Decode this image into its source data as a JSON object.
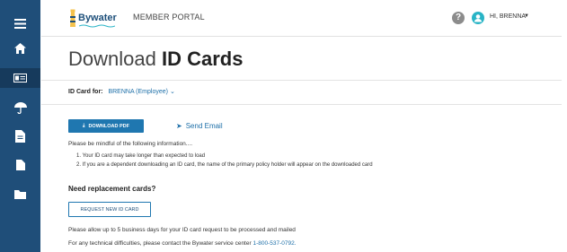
{
  "app": {
    "logo_text": "Bywater",
    "portal_title": "MEMBER PORTAL",
    "help_label": "?",
    "greeting": "HI, BRENNA"
  },
  "sidebar": {
    "icons": [
      "menu-icon",
      "home-icon",
      "id-card-icon",
      "umbrella-icon",
      "document-icon",
      "file-icon",
      "folder-icon"
    ],
    "active": "id-card-icon"
  },
  "page": {
    "title_prefix": "Download",
    "title_main": "ID Cards"
  },
  "idcard": {
    "label": "ID Card for:",
    "selected": "BRENNA (Employee)"
  },
  "actions": {
    "download_label": "DOWNLOAD PDF",
    "send_email_label": "Send Email"
  },
  "info": {
    "intro": "Please be mindful of the following information....",
    "items": [
      "1. Your ID card may take longer than expected to load",
      "2. If you are a dependent downloading an ID card, the name of the primary policy holder will appear on the downloaded card"
    ]
  },
  "replacement": {
    "heading": "Need replacement cards?",
    "button_label": "REQUEST NEW ID CARD",
    "note": "Please allow up to 5 business days for your ID card request to be processed and mailed",
    "support_text": "For any technical difficulties, please contact the Bywater service center",
    "support_phone": "1-800-537-0792."
  },
  "colors": {
    "sidebar": "#1f4e79",
    "primary": "#1f77b0",
    "link": "#1d6fa8",
    "avatar": "#29b4c6"
  }
}
